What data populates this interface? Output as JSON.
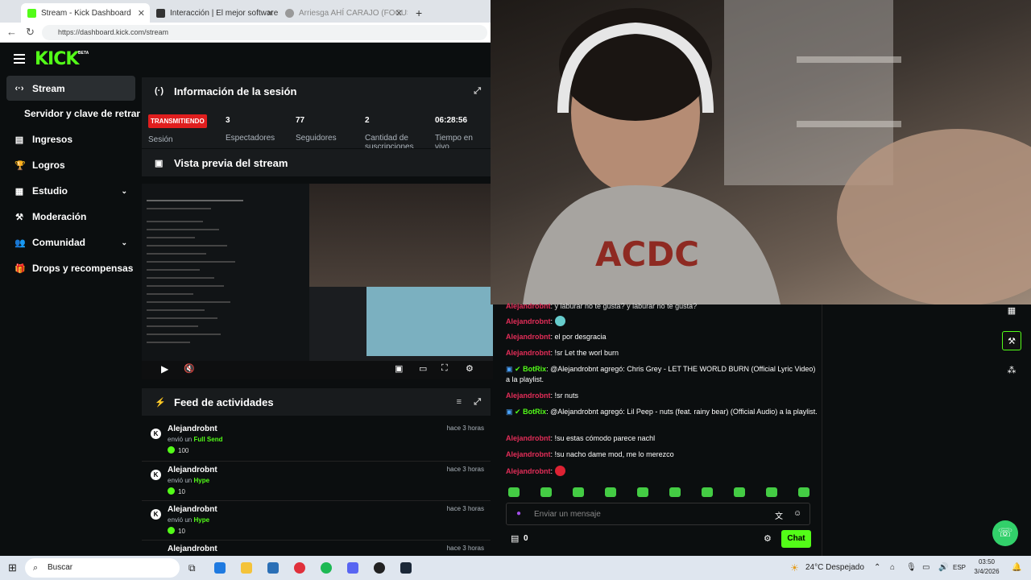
{
  "browser": {
    "tabs": [
      {
        "title": "Stream - Kick Dashboard",
        "active": true
      },
      {
        "title": "Interacción | El mejor software",
        "active": false
      },
      {
        "title": "Arriesga AHÍ CARAJO (FOCUS)",
        "active": false
      }
    ],
    "new_tab": "+",
    "url": "https://dashboard.kick.com/stream"
  },
  "kick": {
    "logo": "KICK",
    "logo_badge": "BETA",
    "sidebar": [
      {
        "label": "Stream",
        "icon": "‹·›"
      },
      {
        "label": "Servidor y clave de retransmisión",
        "icon": ""
      },
      {
        "label": "Ingresos",
        "icon": "▤"
      },
      {
        "label": "Logros",
        "icon": "🏆"
      },
      {
        "label": "Estudio",
        "icon": "▦",
        "chevron": "⌄"
      },
      {
        "label": "Moderación",
        "icon": "⚒"
      },
      {
        "label": "Comunidad",
        "icon": "👥",
        "chevron": "⌄"
      },
      {
        "label": "Drops y recompensas",
        "icon": "🎁"
      }
    ],
    "session": {
      "title": "Información de la sesión",
      "status": "TRANSMITIENDO",
      "session_label": "Sesión",
      "stats": [
        {
          "value": "3",
          "label": "Espectadores"
        },
        {
          "value": "77",
          "label": "Seguidores"
        },
        {
          "value": "2",
          "label": "Cantidad de suscripciones"
        },
        {
          "value": "06:28:56",
          "label": "Tiempo en vivo"
        }
      ]
    },
    "preview": {
      "title": "Vista previa del stream"
    },
    "feed": {
      "title": "Feed de actividades",
      "items": [
        {
          "user": "Alejandrobnt",
          "prefix": "envió un",
          "item": "Full Send",
          "amount": "100",
          "time": "hace 3 horas"
        },
        {
          "user": "Alejandrobnt",
          "prefix": "envió un",
          "item": "Hype",
          "amount": "10",
          "time": "hace 3 horas"
        },
        {
          "user": "Alejandrobnt",
          "prefix": "envió un",
          "item": "Hype",
          "amount": "10",
          "time": "hace 3 horas"
        },
        {
          "user": "Alejandrobnt",
          "prefix": "",
          "item": "",
          "amount": "",
          "time": "hace 3 horas"
        }
      ]
    }
  },
  "chat": {
    "messages": [
      {
        "user": "Alejandrobnt",
        "text": "y laburar no te gusta? y laburar no te gusta?"
      },
      {
        "user": "Alejandrobnt",
        "text": ""
      },
      {
        "user": "Alejandrobnt",
        "text": "el por desgracia"
      },
      {
        "user": "Alejandrobnt",
        "text": "!sr Let the worl burn"
      },
      {
        "bot": "BotRix",
        "text": "@Alejandrobnt agregó: Chris Grey - LET THE WORLD BURN (Official Lyric Video) a la playlist."
      },
      {
        "user": "Alejandrobnt",
        "text": "!sr nuts"
      },
      {
        "bot": "BotRix",
        "text": "@Alejandrobnt agregó: Lil Peep - nuts (feat. rainy bear) (Official Audio) a la playlist."
      },
      {
        "user": "Alejandrobnt",
        "text": "!su estas cómodo parece nachl"
      },
      {
        "user": "Alejandrobnt",
        "text": "!su nacho dame mod, me lo merezco"
      },
      {
        "user": "Alejandrobnt",
        "text": ""
      }
    ],
    "input_placeholder": "Enviar un mensaje",
    "points": "0",
    "send_label": "Chat"
  },
  "taskbar": {
    "search_placeholder": "Buscar",
    "weather": "24°C  Despejado",
    "lang": "ESP",
    "time": "03:50",
    "date": "3/4/2026"
  },
  "colors": {
    "accent": "#53fc18",
    "live": "#e01e1e",
    "chat_user": "#e32d58"
  }
}
